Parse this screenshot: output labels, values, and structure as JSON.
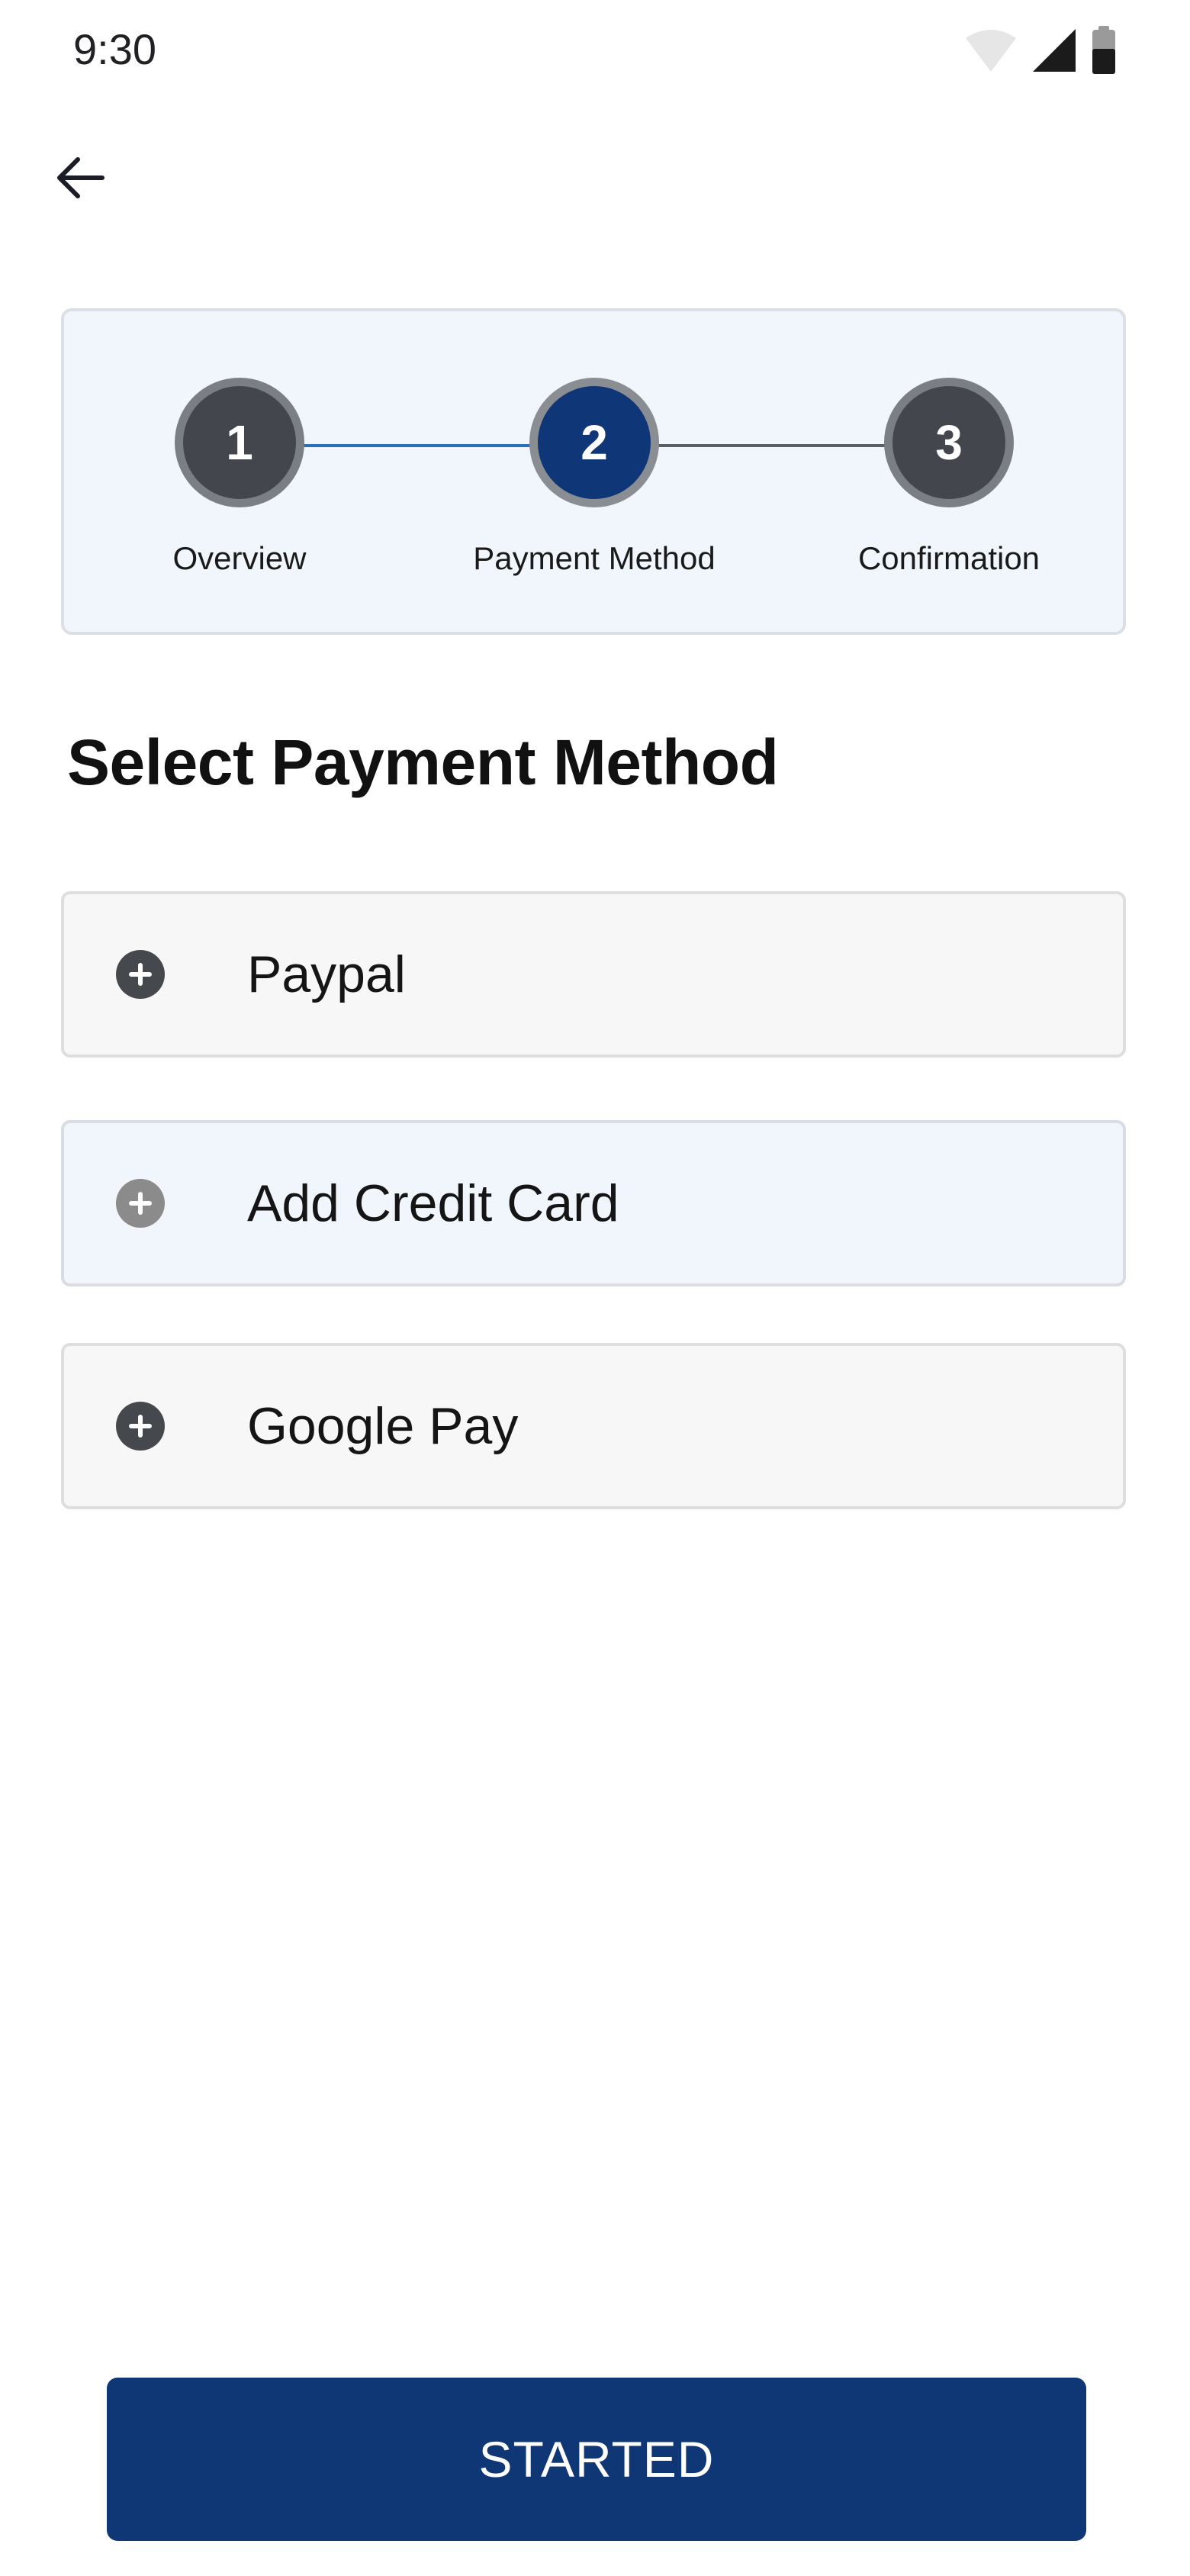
{
  "status_bar": {
    "time": "9:30",
    "icons": [
      "wifi-icon",
      "signal-icon",
      "battery-icon"
    ]
  },
  "header": {
    "back_icon": "arrow-left-icon"
  },
  "stepper": {
    "current_step": 2,
    "steps": [
      {
        "number": "1",
        "label": "Overview"
      },
      {
        "number": "2",
        "label": "Payment Method"
      },
      {
        "number": "3",
        "label": "Confirmation"
      }
    ]
  },
  "title": "Select Payment Method",
  "payment_options": [
    {
      "label": "Paypal",
      "icon": "plus-circle-icon"
    },
    {
      "label": "Add Credit Card",
      "icon": "plus-circle-icon"
    },
    {
      "label": "Google Pay",
      "icon": "plus-circle-icon"
    }
  ],
  "primary_button": {
    "label": "STARTED"
  },
  "colors": {
    "primary": "#0f3776",
    "step_inactive": "#43464c",
    "progress_line": "#2b6ec0",
    "card_tint": "#f1f6fc"
  }
}
